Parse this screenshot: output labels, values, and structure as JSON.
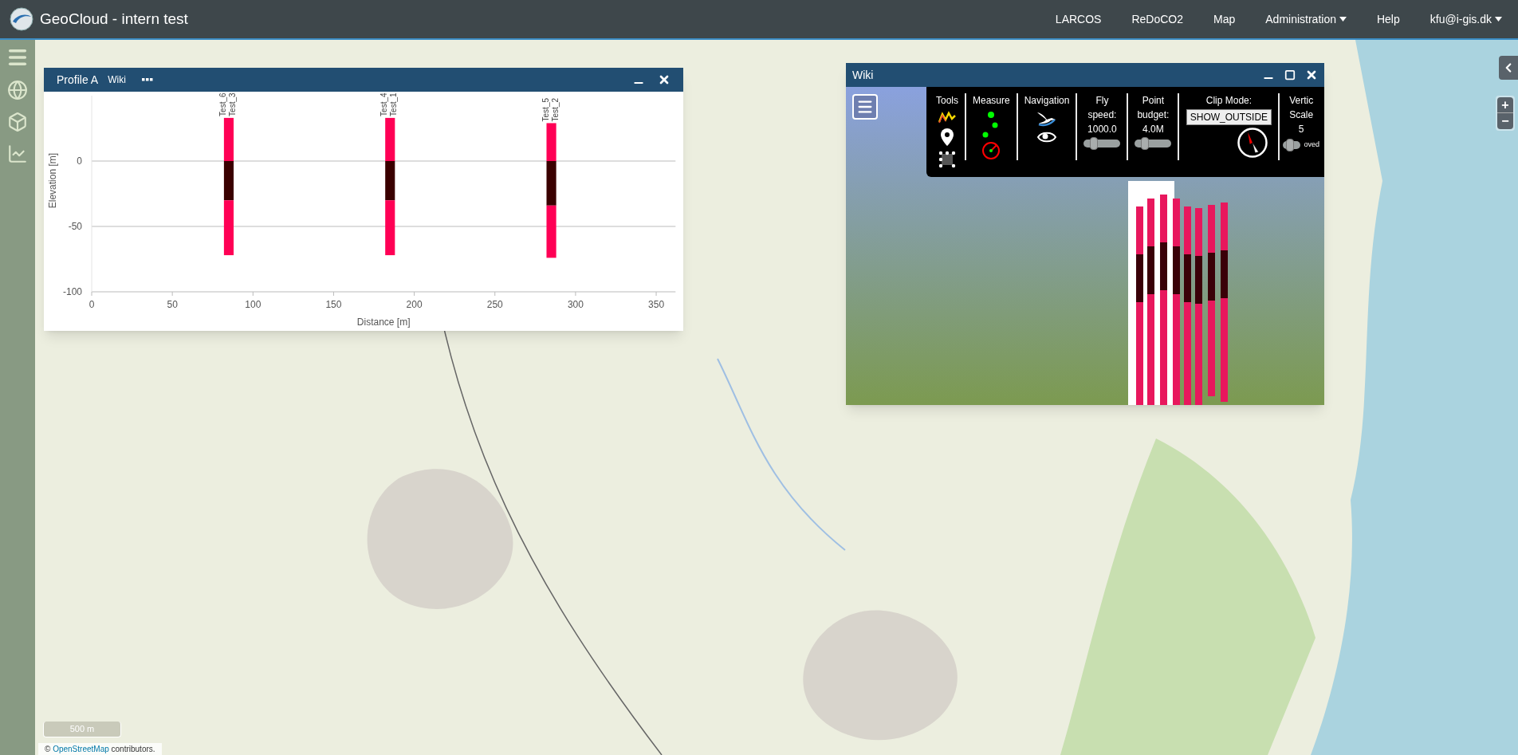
{
  "header": {
    "title": "GeoCloud - intern test",
    "nav": [
      {
        "label": "LARCOS",
        "dropdown": false
      },
      {
        "label": "ReDoCO2",
        "dropdown": false
      },
      {
        "label": "Map",
        "dropdown": false
      },
      {
        "label": "Administration",
        "dropdown": true
      },
      {
        "label": "Help",
        "dropdown": false
      },
      {
        "label": "kfu@i-gis.dk",
        "dropdown": true
      }
    ]
  },
  "profile_window": {
    "title": "Profile A",
    "tab": "Wiki",
    "chart_data": {
      "type": "bar",
      "xlabel": "Distance [m]",
      "ylabel": "Elevation [m]",
      "stacked": true,
      "xlim": [
        0,
        362
      ],
      "ylim": [
        -100,
        50
      ],
      "xticks": [
        0,
        50,
        100,
        150,
        200,
        250,
        300,
        350
      ],
      "yticks": [
        -100,
        -50,
        0
      ],
      "x": [
        85,
        185,
        285
      ],
      "series": [
        {
          "color": "#ff0055",
          "values": [
            33,
            33,
            29
          ]
        },
        {
          "color": "#3a0000",
          "values": [
            -30,
            -30,
            -34
          ]
        },
        {
          "color": "#ff0055",
          "values": [
            -42,
            -42,
            -40
          ]
        }
      ],
      "annotations": [
        "Test_6",
        "Test_3",
        "Test_4",
        "Test_1",
        "Test_5",
        "Test_2"
      ]
    }
  },
  "viewer_window": {
    "title": "Wiki",
    "toolbar": [
      {
        "kind": "icons",
        "label": "Tools"
      },
      {
        "kind": "icons",
        "label": "Measure"
      },
      {
        "kind": "icons",
        "label": "Navigation"
      },
      {
        "kind": "slider",
        "label": "Fly",
        "sublabel": "speed:",
        "value": "1000.0",
        "level": 0.2
      },
      {
        "kind": "slider",
        "label": "Point",
        "sublabel": "budget:",
        "value": "4.0M",
        "level": 0.2
      },
      {
        "kind": "select",
        "label": "Clip Mode:",
        "value": "SHOW_OUTSIDE"
      },
      {
        "kind": "slider",
        "label": "Vertic",
        "sublabel": "Scale",
        "value": "5",
        "level": 0.3,
        "note": "oved"
      }
    ]
  },
  "map_controls": {
    "zoom": [
      "+",
      "−"
    ]
  },
  "scale_bar": "500 m",
  "attribution": {
    "symbol": "©",
    "link": "OpenStreetMap",
    "text": "contributors."
  }
}
